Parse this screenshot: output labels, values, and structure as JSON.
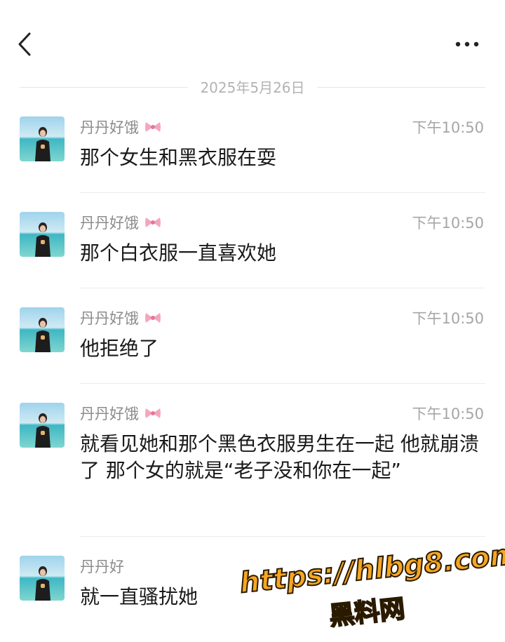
{
  "header": {
    "back_icon": "chevron-left-icon",
    "more_icon": "ellipsis-icon"
  },
  "date_divider": "2025年5月26日",
  "messages": [
    {
      "sender": "丹丹好饿",
      "sender_emoji": "bow-icon",
      "time": "下午10:50",
      "text": "那个女生和黑衣服在耍"
    },
    {
      "sender": "丹丹好饿",
      "sender_emoji": "bow-icon",
      "time": "下午10:50",
      "text": "那个白衣服一直喜欢她"
    },
    {
      "sender": "丹丹好饿",
      "sender_emoji": "bow-icon",
      "time": "下午10:50",
      "text": "他拒绝了"
    },
    {
      "sender": "丹丹好饿",
      "sender_emoji": "bow-icon",
      "time": "下午10:50",
      "text": "就看见她和那个黑色衣服男生在一起 他就崩溃了 那个女的就是“老子没和你在一起”"
    },
    {
      "sender": "丹丹好",
      "sender_emoji": "",
      "time": "",
      "text": "就一直骚扰她"
    }
  ],
  "watermark": {
    "url": "https://hlbg8.com",
    "name": "黑料网"
  },
  "colors": {
    "watermark_fill": "#f5a623",
    "watermark_stroke": "#2a1a00",
    "secondary_text": "#8c8c8c"
  }
}
